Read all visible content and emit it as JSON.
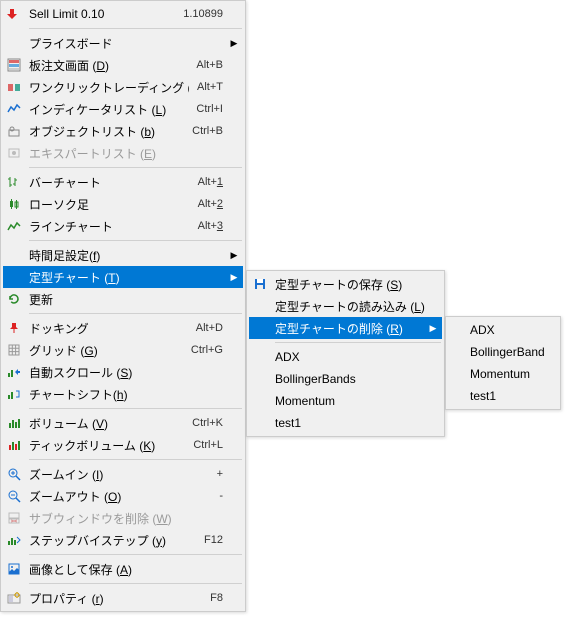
{
  "main": [
    {
      "icon": "sell-arrow",
      "label": "Sell Limit 0.10",
      "shortcut": "1.10899",
      "disabled": false,
      "arrow": false,
      "under": ""
    },
    {
      "sep": true
    },
    {
      "icon": "",
      "label": "プライスボード",
      "shortcut": "",
      "disabled": false,
      "arrow": true,
      "under": ""
    },
    {
      "icon": "dom",
      "label": "板注文画面 (D)",
      "shortcut": "Alt+B",
      "disabled": false,
      "arrow": false,
      "under": "D"
    },
    {
      "icon": "oneclick",
      "label": "ワンクリックトレーディング (k)",
      "shortcut": "Alt+T",
      "disabled": false,
      "arrow": false,
      "under": "k"
    },
    {
      "icon": "indicator",
      "label": "インディケータリスト (L)",
      "shortcut": "Ctrl+I",
      "disabled": false,
      "arrow": false,
      "under": "L"
    },
    {
      "icon": "object",
      "label": "オブジェクトリスト (b)",
      "shortcut": "Ctrl+B",
      "disabled": false,
      "arrow": false,
      "under": "b"
    },
    {
      "icon": "expert",
      "label": "エキスパートリスト (E)",
      "shortcut": "",
      "disabled": true,
      "arrow": false,
      "under": "E"
    },
    {
      "sep": true
    },
    {
      "icon": "barchart",
      "label": "バーチャート",
      "shortcut": "Alt+1",
      "disabled": false,
      "arrow": false,
      "under": "",
      "sunder": "1"
    },
    {
      "icon": "candle",
      "label": "ローソク足",
      "shortcut": "Alt+2",
      "disabled": false,
      "arrow": false,
      "under": "",
      "sunder": "2"
    },
    {
      "icon": "linechart",
      "label": "ラインチャート",
      "shortcut": "Alt+3",
      "disabled": false,
      "arrow": false,
      "under": "",
      "sunder": "3"
    },
    {
      "sep": true
    },
    {
      "icon": "",
      "label": "時間足設定(f)",
      "shortcut": "",
      "disabled": false,
      "arrow": true,
      "under": "f"
    },
    {
      "icon": "",
      "label": "定型チャート (T)",
      "shortcut": "",
      "disabled": false,
      "arrow": true,
      "under": "T",
      "highlight": true
    },
    {
      "icon": "refresh",
      "label": "更新",
      "shortcut": "",
      "disabled": false,
      "arrow": false,
      "under": ""
    },
    {
      "sep": true
    },
    {
      "icon": "pin",
      "label": "ドッキング",
      "shortcut": "Alt+D",
      "disabled": false,
      "arrow": false,
      "under": ""
    },
    {
      "icon": "grid",
      "label": "グリッド (G)",
      "shortcut": "Ctrl+G",
      "disabled": false,
      "arrow": false,
      "under": "G"
    },
    {
      "icon": "autoscroll",
      "label": "自動スクロール (S)",
      "shortcut": "",
      "disabled": false,
      "arrow": false,
      "under": "S"
    },
    {
      "icon": "shift",
      "label": "チャートシフト(h)",
      "shortcut": "",
      "disabled": false,
      "arrow": false,
      "under": "h"
    },
    {
      "sep": true
    },
    {
      "icon": "volume",
      "label": "ボリューム (V)",
      "shortcut": "Ctrl+K",
      "disabled": false,
      "arrow": false,
      "under": "V"
    },
    {
      "icon": "tickvol",
      "label": "ティックボリューム (K)",
      "shortcut": "Ctrl+L",
      "disabled": false,
      "arrow": false,
      "under": "K"
    },
    {
      "sep": true
    },
    {
      "icon": "zoomin",
      "label": "ズームイン (I)",
      "shortcut": "+",
      "disabled": false,
      "arrow": false,
      "under": "I"
    },
    {
      "icon": "zoomout",
      "label": "ズームアウト (O)",
      "shortcut": "-",
      "disabled": false,
      "arrow": false,
      "under": "O"
    },
    {
      "icon": "delsub",
      "label": "サブウィンドウを削除 (W)",
      "shortcut": "",
      "disabled": true,
      "arrow": false,
      "under": "W"
    },
    {
      "icon": "step",
      "label": "ステップバイステップ (y)",
      "shortcut": "F12",
      "disabled": false,
      "arrow": false,
      "under": "y"
    },
    {
      "sep": true
    },
    {
      "icon": "saveimg",
      "label": "画像として保存 (A)",
      "shortcut": "",
      "disabled": false,
      "arrow": false,
      "under": "A"
    },
    {
      "sep": true
    },
    {
      "icon": "properties",
      "label": "プロパティ (r)",
      "shortcut": "F8",
      "disabled": false,
      "arrow": false,
      "under": "r"
    }
  ],
  "sub1": [
    {
      "icon": "save",
      "label": "定型チャートの保存 (S)",
      "under": "S"
    },
    {
      "icon": "",
      "label": "定型チャートの読み込み (L)",
      "under": "L"
    },
    {
      "icon": "",
      "label": "定型チャートの削除 (R)",
      "under": "R",
      "arrow": true,
      "highlight": true
    },
    {
      "sep": true
    },
    {
      "icon": "",
      "label": "ADX"
    },
    {
      "icon": "",
      "label": "BollingerBands"
    },
    {
      "icon": "",
      "label": "Momentum"
    },
    {
      "icon": "",
      "label": "test1"
    }
  ],
  "sub2": [
    {
      "label": "ADX"
    },
    {
      "label": "BollingerBands"
    },
    {
      "label": "Momentum"
    },
    {
      "label": "test1"
    }
  ]
}
